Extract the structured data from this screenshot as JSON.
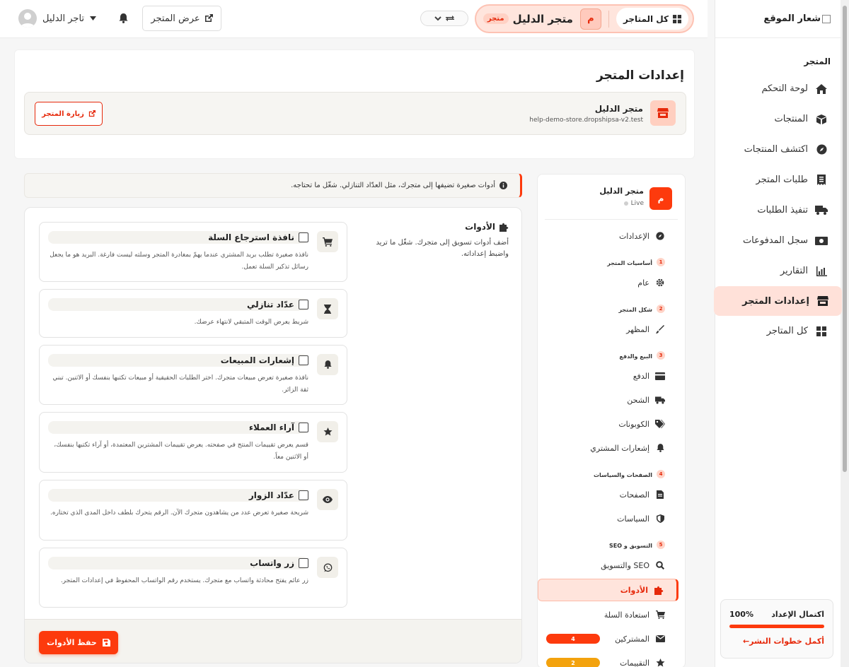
{
  "colors": {
    "accent": "#fd3a0d",
    "accent_light": "#ffe1d9",
    "badge_orange": "#fd3a0d",
    "badge_amber": "#f3a20d"
  },
  "sidebar": {
    "logo_alt": "شعار الموقع",
    "section": "المتجر",
    "items": [
      {
        "label": "لوحة التحكم",
        "icon": "home-icon"
      },
      {
        "label": "المنتجات",
        "icon": "box-icon"
      },
      {
        "label": "اكتشف المنتجات",
        "icon": "compass-icon"
      },
      {
        "label": "طلبات المتجر",
        "icon": "receipt-icon"
      },
      {
        "label": "تنفيذ الطلبات",
        "icon": "truck-icon"
      },
      {
        "label": "سجل المدفوعات",
        "icon": "money-icon"
      },
      {
        "label": "التقارير",
        "icon": "chart-icon"
      },
      {
        "label": "إعدادات المتجر",
        "icon": "store-icon",
        "active": true
      },
      {
        "label": "كل المتاجر",
        "icon": "grid-icon"
      }
    ],
    "setup": {
      "title": "اكتمال الإعداد",
      "percent": "100%",
      "progress": 1.0,
      "link": "أكمل خطوات النشر←"
    }
  },
  "topbar": {
    "all_stores": "كل المتاجر",
    "store_initial": "م",
    "store_name": "متجر الدليل",
    "store_tag": "متجر",
    "view_store": "عرض المتجر",
    "user_name": "تاجر الدليل"
  },
  "page": {
    "title": "إعدادات المتجر",
    "store_name": "متجر الدليل",
    "store_url": "help-demo-store.dropshipsa-v2.test",
    "visit_button": "زيارة المتجر"
  },
  "settings_nav": {
    "store_initial": "م",
    "store_name": "متجر الدليل",
    "status": "Live",
    "settings": "الإعدادات",
    "groups": [
      {
        "num": "1",
        "title": "أساسيات المتجر",
        "items": [
          {
            "label": "عام",
            "icon": "gear-icon"
          }
        ]
      },
      {
        "num": "2",
        "title": "شكل المتجر",
        "items": [
          {
            "label": "المظهر",
            "icon": "brush-icon"
          }
        ]
      },
      {
        "num": "3",
        "title": "البيع والدفع",
        "items": [
          {
            "label": "الدفع",
            "icon": "card-icon"
          },
          {
            "label": "الشحن",
            "icon": "truck-icon"
          },
          {
            "label": "الكوبونات",
            "icon": "tags-icon"
          },
          {
            "label": "إشعارات المشتري",
            "icon": "bell-icon"
          }
        ]
      },
      {
        "num": "4",
        "title": "الصفحات والسياسات",
        "items": [
          {
            "label": "الصفحات",
            "icon": "file-icon"
          },
          {
            "label": "السياسات",
            "icon": "shield-icon"
          }
        ]
      },
      {
        "num": "5",
        "title": "التسويق و SEO",
        "items": [
          {
            "label": "SEO والتسويق",
            "icon": "search-icon"
          },
          {
            "label": "الأدوات",
            "icon": "puzzle-icon",
            "active": true
          },
          {
            "label": "استعادة السلة",
            "icon": "cart-icon"
          },
          {
            "label": "المشتركين",
            "icon": "envelope-icon",
            "badge": "4",
            "badge_color": "#fd3a0d"
          },
          {
            "label": "التقييمات",
            "icon": "star-icon",
            "badge": "2",
            "badge_color": "#f3a20d"
          }
        ]
      }
    ]
  },
  "info_banner": "أدوات صغيرة تضيفها إلى متجرك، مثل العدّاد التنازلي. شغّل ما تحتاجه.",
  "tools": {
    "title": "الأدوات",
    "description": "أضف أدوات تسويق إلى متجرك. شغّل ما تريد واضبط إعداداته.",
    "items": [
      {
        "name": "نافذة استرجاع السلة",
        "icon": "cart-icon",
        "description": "نافذة صغيرة تطلب بريد المشتري عندما يهمّ بمغادرة المتجر وسلته ليست فارغة. البريد هو ما يجعل رسائل تذكير السلة تعمل."
      },
      {
        "name": "عدّاد تنازلي",
        "icon": "hourglass-icon",
        "description": "شريط يعرض الوقت المتبقي لانتهاء عرضك."
      },
      {
        "name": "إشعارات المبيعات",
        "icon": "bell-icon",
        "description": "نافذة صغيرة تعرض مبيعات متجرك. اختر الطلبات الحقيقية أو مبيعات تكتبها بنفسك أو الاثنين. تبني ثقة الزائر."
      },
      {
        "name": "آراء العملاء",
        "icon": "star-icon",
        "description": "قسم يعرض تقييمات المنتج في صفحته. يعرض تقييمات المشترين المعتمدة، أو آراء تكتبها بنفسك، أو الاثنين معاً."
      },
      {
        "name": "عدّاد الزوار",
        "icon": "eye-icon",
        "description": "شريحة صغيرة تعرض عدد من يشاهدون متجرك الآن. الرقم يتحرك بلطف داخل المدى الذي تختاره."
      },
      {
        "name": "زر واتساب",
        "icon": "whatsapp-icon",
        "description": "زر عائم يفتح محادثة واتساب مع متجرك. يستخدم رقم الواتساب المحفوظ في إعدادات المتجر."
      }
    ],
    "save_button": "حفظ الأدوات"
  }
}
